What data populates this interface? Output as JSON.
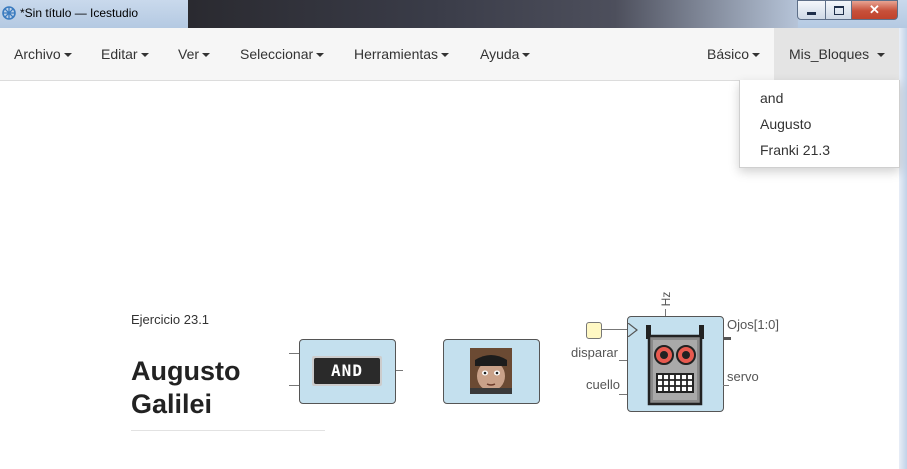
{
  "window": {
    "title": "*Sin título — Icestudio",
    "buttons": {
      "minimize": "minimize-icon",
      "maximize": "maximize-icon",
      "close": "close-icon"
    }
  },
  "menu": {
    "archivo": "Archivo",
    "editar": "Editar",
    "ver": "Ver",
    "seleccionar": "Seleccionar",
    "herramientas": "Herramientas",
    "ayuda": "Ayuda",
    "basico": "Básico",
    "mis_bloques": "Mis_Bloques"
  },
  "dropdown": {
    "items": [
      "and",
      "Augusto",
      "Franki 21.3"
    ]
  },
  "canvas": {
    "exercise_label": "Ejercicio 23.1",
    "heading_line1": "Augusto",
    "heading_line2": "Galilei",
    "and_block_label": "AND",
    "franki": {
      "param": "Hz",
      "inputs": [
        "disparar",
        "cuello"
      ],
      "outputs": [
        "Ojos[1:0]",
        "servo"
      ]
    }
  },
  "colors": {
    "block_fill": "#c4e0ee",
    "menubar_bg": "#f6f6f6",
    "input_port": "#fff8c4"
  }
}
